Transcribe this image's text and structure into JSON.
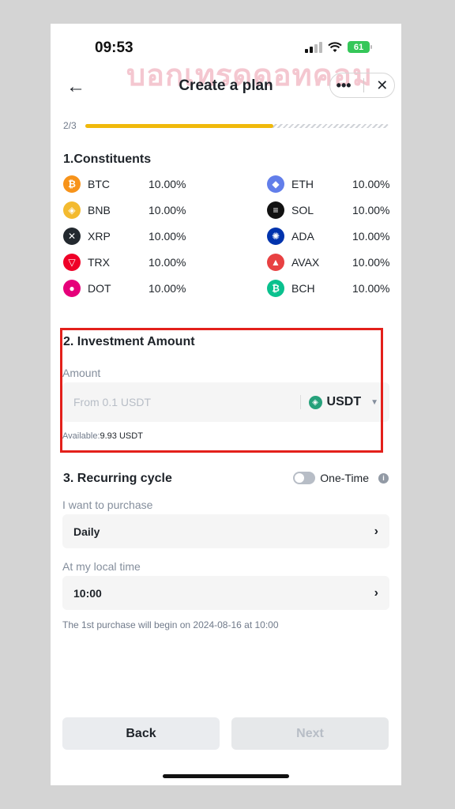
{
  "status_bar": {
    "time": "09:53",
    "battery": "61"
  },
  "watermark": "บอกเทรดดอทคอม",
  "header": {
    "title": "Create a plan",
    "more": "•••",
    "close": "✕",
    "back": "←"
  },
  "progress": {
    "label": "2/3",
    "fraction": 0.62
  },
  "constituents": {
    "title": "1.Constituents",
    "items": [
      {
        "symbol": "BTC",
        "pct": "10.00%",
        "icon_text": "₿",
        "color": "#f7931a"
      },
      {
        "symbol": "ETH",
        "pct": "10.00%",
        "icon_text": "◆",
        "color": "#627eea"
      },
      {
        "symbol": "BNB",
        "pct": "10.00%",
        "icon_text": "◈",
        "color": "#f3ba2f"
      },
      {
        "symbol": "SOL",
        "pct": "10.00%",
        "icon_text": "≡",
        "color": "#111111"
      },
      {
        "symbol": "XRP",
        "pct": "10.00%",
        "icon_text": "✕",
        "color": "#23292f"
      },
      {
        "symbol": "ADA",
        "pct": "10.00%",
        "icon_text": "✺",
        "color": "#0033ad"
      },
      {
        "symbol": "TRX",
        "pct": "10.00%",
        "icon_text": "▽",
        "color": "#ef0027"
      },
      {
        "symbol": "AVAX",
        "pct": "10.00%",
        "icon_text": "▲",
        "color": "#e84142"
      },
      {
        "symbol": "DOT",
        "pct": "10.00%",
        "icon_text": "●",
        "color": "#e6007a"
      },
      {
        "symbol": "BCH",
        "pct": "10.00%",
        "icon_text": "₿",
        "color": "#0ac18e"
      }
    ]
  },
  "investment": {
    "title": "2. Investment Amount",
    "amount_label": "Amount",
    "placeholder": "From 0.1 USDT",
    "currency": "USDT",
    "available_label": "Available:",
    "available_value": "9.93 USDT"
  },
  "recurring": {
    "title": "3. Recurring cycle",
    "toggle_label": "One-Time",
    "purchase_label": "I want to purchase",
    "purchase_value": "Daily",
    "time_label": "At my local time",
    "time_value": "10:00",
    "note": "The 1st purchase will begin on 2024-08-16 at 10:00"
  },
  "footer": {
    "back_label": "Back",
    "next_label": "Next"
  }
}
